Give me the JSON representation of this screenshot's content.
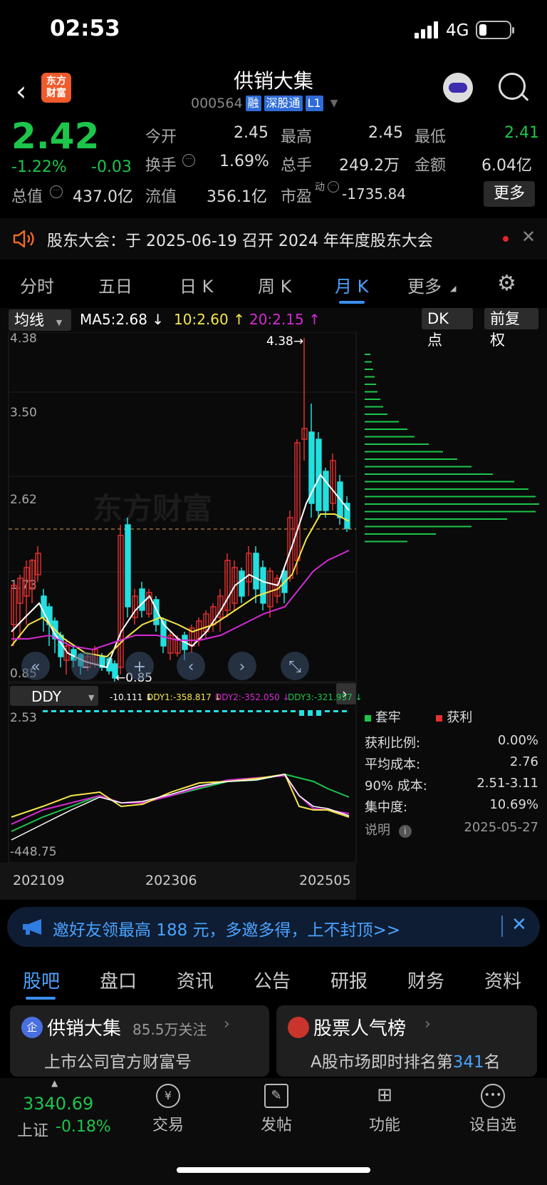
{
  "status": {
    "time": "02:53",
    "network": "4G"
  },
  "header": {
    "title": "供销大集",
    "code": "000564",
    "tags": [
      "融",
      "深股通",
      "L1"
    ]
  },
  "quote": {
    "price": "2.42",
    "pct": "-1.22%",
    "chg": "-0.03",
    "fields": [
      {
        "label": "今开",
        "value": "2.45"
      },
      {
        "label": "最高",
        "value": "2.45"
      },
      {
        "label": "最低",
        "value": "2.41"
      },
      {
        "label": "换手",
        "value": "1.69%"
      },
      {
        "label": "总手",
        "value": "249.2万"
      },
      {
        "label": "金额",
        "value": "6.04亿"
      },
      {
        "label": "总值",
        "value": "437.0亿"
      },
      {
        "label": "流值",
        "value": "356.1亿"
      },
      {
        "label": "市盈",
        "sup": "动",
        "value": "-1735.84"
      }
    ],
    "more": "更多"
  },
  "notice": {
    "text": "股东大会：于 2025-06-19 召开 2024 年年度股东大会"
  },
  "chart_tabs": [
    "分时",
    "五日",
    "日 K",
    "周 K",
    "月 K",
    "更多"
  ],
  "active_tab": "月 K",
  "kline": {
    "indicator_select": "均线",
    "ma5": "MA5:2.68",
    "ma10": "10:2.60",
    "ma20": "20:2.15",
    "dk_button": "DK 点",
    "adjust_button": "前复权",
    "y_labels": [
      "4.38",
      "3.50",
      "2.62",
      "1.73",
      "0.85"
    ],
    "max_label": "4.38",
    "min_label": "0.85",
    "watermark": "东方财富",
    "colors": {
      "up": "#e53030",
      "down": "#22e0e0",
      "ma5": "#ffffff",
      "ma10": "#f5e64a",
      "ma20": "#d42ad4"
    }
  },
  "ddy": {
    "select": "DDY",
    "vals": [
      "-10.111",
      "DDY1:-358.817",
      "DDY2:-352.050",
      "DDY3:-321.957"
    ],
    "y_top": "2.53",
    "y_bottom": "-448.75",
    "x_labels": [
      "202109",
      "202306",
      "202505"
    ]
  },
  "chip": {
    "legend": [
      "套牢",
      "获利"
    ],
    "stats": [
      {
        "label": "获利比例:",
        "value": "0.00%"
      },
      {
        "label": "平均成本:",
        "value": "2.76"
      },
      {
        "label": "90% 成本:",
        "value": "2.51-3.11"
      },
      {
        "label": "集中度:",
        "value": "10.69%"
      }
    ],
    "note_label": "说明",
    "note_date": "2025-05-27"
  },
  "banner": {
    "text": "邀好友领最高 188 元，多邀多得，上不封顶>>"
  },
  "bottom_tabs": [
    "股吧",
    "盘口",
    "资讯",
    "公告",
    "研报",
    "财务",
    "资料"
  ],
  "cards": [
    {
      "title": "供销大集",
      "meta": "85.5万关注",
      "sub": "上市公司官方财富号"
    },
    {
      "title": "股票人气榜",
      "sub_prefix": "A股市场即时排名第",
      "rank": "341",
      "sub_suffix": "名"
    }
  ],
  "bottom_bar": {
    "index_value": "3340.69",
    "index_name": "上证",
    "index_pct": "-0.18%",
    "items": [
      "交易",
      "发帖",
      "功能",
      "设自选"
    ]
  }
}
